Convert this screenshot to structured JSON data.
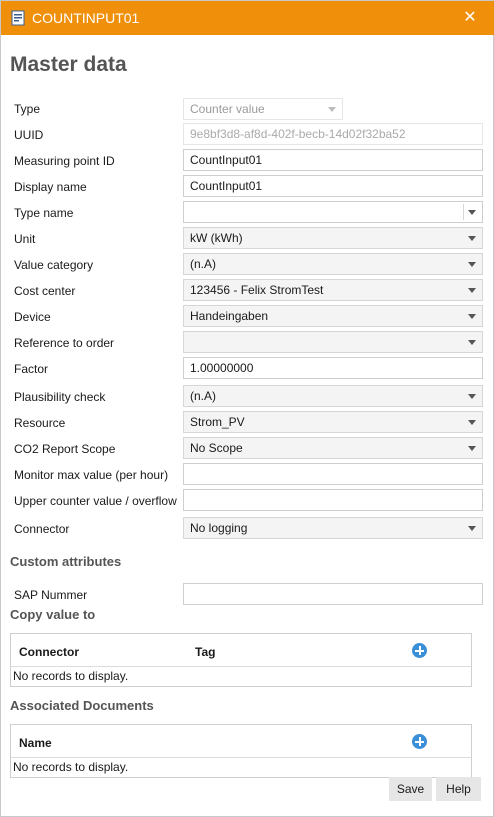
{
  "window": {
    "title": "COUNTINPUT01",
    "app_icon": "document-icon",
    "close_glyph": "✕",
    "accent_color": "#f0900a"
  },
  "master": {
    "heading": "Master data",
    "fields": {
      "type": {
        "label": "Type",
        "value": "Counter value"
      },
      "uuid": {
        "label": "UUID",
        "value": "9e8bf3d8-af8d-402f-becb-14d02f32ba52"
      },
      "measuring_point_id": {
        "label": "Measuring point ID",
        "value": "CountInput01"
      },
      "display_name": {
        "label": "Display name",
        "value": "CountInput01"
      },
      "type_name": {
        "label": "Type name",
        "value": ""
      },
      "unit": {
        "label": "Unit",
        "value": "kW (kWh)"
      },
      "value_category": {
        "label": "Value category",
        "value": "(n.A)"
      },
      "cost_center": {
        "label": "Cost center",
        "value": "123456 - Felix StromTest"
      },
      "device": {
        "label": "Device",
        "value": "Handeingaben"
      },
      "reference_to_order": {
        "label": "Reference to order",
        "value": ""
      },
      "factor": {
        "label": "Factor",
        "value": "1.00000000"
      },
      "plausibility_check": {
        "label": "Plausibility check",
        "value": "(n.A)"
      },
      "resource": {
        "label": "Resource",
        "value": "Strom_PV"
      },
      "co2_report_scope": {
        "label": "CO2 Report Scope",
        "value": "No Scope"
      },
      "monitor_max_value": {
        "label": "Monitor max value (per hour)",
        "value": ""
      },
      "upper_counter_value": {
        "label": "Upper counter value / overflow",
        "value": ""
      },
      "connector": {
        "label": "Connector",
        "value": "No logging"
      }
    }
  },
  "custom_attributes": {
    "heading": "Custom attributes",
    "sap_nummer": {
      "label": "SAP Nummer",
      "value": ""
    }
  },
  "copy_value_to": {
    "heading": "Copy value to",
    "columns": [
      "Connector",
      "Tag"
    ],
    "empty_text": "No records to display."
  },
  "associated_documents": {
    "heading": "Associated Documents",
    "columns": [
      "Name"
    ],
    "empty_text": "No records to display."
  },
  "footer": {
    "save_label": "Save",
    "help_label": "Help"
  }
}
